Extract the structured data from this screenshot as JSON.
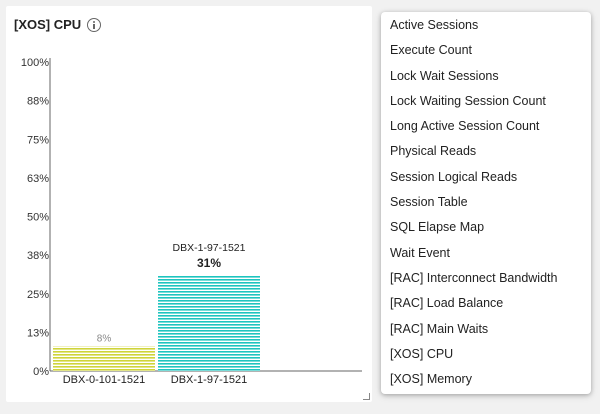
{
  "panel": {
    "title": "[XOS] CPU",
    "info_icon": "info-icon"
  },
  "chart_data": {
    "type": "bar",
    "title": "[XOS] CPU",
    "ylim": [
      0,
      100
    ],
    "y_ticks": [
      "0%",
      "13%",
      "25%",
      "38%",
      "50%",
      "63%",
      "75%",
      "88%",
      "100%"
    ],
    "categories": [
      "DBX-0-101-1521",
      "DBX-1-97-1521"
    ],
    "values": [
      8,
      31
    ],
    "value_labels": [
      "8%",
      "31%"
    ],
    "series_labels": [
      "",
      "DBX-1-97-1521"
    ],
    "colors": [
      "#cfd43a",
      "#1ec4bf"
    ]
  },
  "menu": {
    "items": [
      "Active Sessions",
      "Execute Count",
      "Lock Wait Sessions",
      "Lock Waiting Session Count",
      "Long Active Session Count",
      "Physical Reads",
      "Session Logical Reads",
      "Session Table",
      "SQL Elapse Map",
      "Wait Event",
      "[RAC] Interconnect Bandwidth",
      "[RAC] Load Balance",
      "[RAC] Main Waits",
      "[XOS] CPU",
      "[XOS] Memory"
    ]
  }
}
